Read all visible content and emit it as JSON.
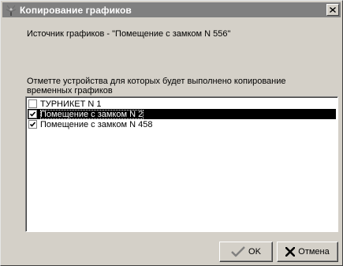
{
  "window": {
    "title": "Копирование графиков",
    "icon": "app-icon",
    "close_icon": "close-icon"
  },
  "dialog": {
    "source_label": "Источник графиков - \"Помещение с замком N 556\"",
    "instruction": "Отметте устройства для которых будет выполнено копирование временных графиков"
  },
  "devices": [
    {
      "label": "ТУРНИКЕТ N 1",
      "checked": false,
      "selected": false
    },
    {
      "label": "Помещение с замком N 2",
      "checked": true,
      "selected": true
    },
    {
      "label": "Помещение с замком N 458",
      "checked": true,
      "selected": false
    }
  ],
  "buttons": {
    "ok": {
      "label": "OK",
      "icon": "checkmark-icon",
      "icon_color": "#808080"
    },
    "cancel": {
      "label": "Отмена",
      "icon": "x-icon",
      "icon_color": "#000000"
    }
  },
  "colors": {
    "titlebar_bg": "#808080",
    "dialog_bg": "#d4d0c8",
    "selection_bg": "#000000"
  }
}
